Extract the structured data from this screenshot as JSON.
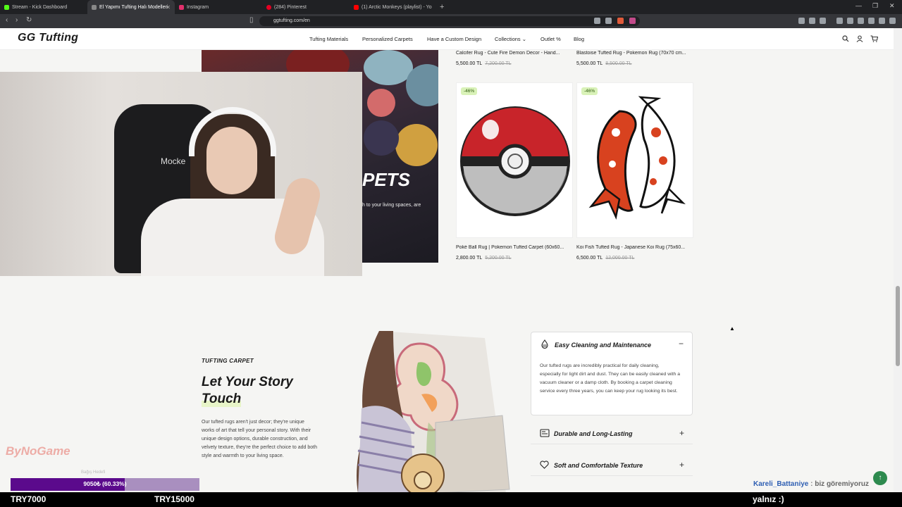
{
  "browser": {
    "tabs": [
      {
        "title": "Stream - Kick Dashboard",
        "color": "#53fc18"
      },
      {
        "title": "El Yapımı Tufting Halı Modelleri",
        "color": "#888888",
        "active": true
      },
      {
        "title": "Instagram",
        "color": "#e1306c"
      },
      {
        "title": "(284) Pinterest",
        "color": "#e60023"
      },
      {
        "title": "(1) Arctic Monkeys (playlist) - Yo",
        "color": "#ff0000"
      }
    ],
    "url": "ggtufting.com/en"
  },
  "site": {
    "logo": "GG Tufting",
    "nav": [
      "Tufting Materials",
      "Personalized Carpets",
      "Have a Custom Design",
      "Collections ⌄",
      "Outlet %",
      "Blog"
    ]
  },
  "hero": {
    "title": "PETS",
    "text": "h to your living spaces, are"
  },
  "webcam": {
    "chair_text": "Mocke"
  },
  "products_top": [
    {
      "title": "Calcifer Rug - Cute Fire Demon Decor - Hand...",
      "price": "5,500.00 TL",
      "old_price": "7,200.00 TL"
    },
    {
      "title": "Blastoise Tufted Rug - Pokemon Rug (70x70 cm...",
      "price": "5,500.00 TL",
      "old_price": "8,500.00 TL"
    }
  ],
  "products": [
    {
      "discount": "-46%",
      "title": "Poké Ball Rug | Pokemon Tufted Carpet (60x60...",
      "price": "2,800.00 TL",
      "old_price": "5,200.00 TL"
    },
    {
      "discount": "-46%",
      "title": "Koi Fish Tufted Rug - Japanese Koi Rug (75x60...",
      "price": "6,500.00 TL",
      "old_price": "12,000.00 TL"
    }
  ],
  "section": {
    "kicker": "TUFTING CARPET",
    "heading_line1": "Let Your Story",
    "heading_line2": "Touch",
    "body": "Our tufted rugs aren't just decor; they're unique works of art that tell your personal story. With their unique design options, durable construction, and velvety texture, they're the perfect choice to add both style and warmth to your living space."
  },
  "accordion": [
    {
      "title": "Easy Cleaning and Maintenance",
      "icon": "droplet-icon",
      "toggle": "−",
      "body": "Our tufted rugs are incredibly practical for daily cleaning, especially for light dirt and dust. They can be easily cleaned with a vacuum cleaner or a damp cloth. By booking a carpet cleaning service every three years, you can keep your rug looking its best."
    },
    {
      "title": "Durable and Long-Lasting",
      "icon": "shield-icon",
      "toggle": "+"
    },
    {
      "title": "Soft and Comfortable Texture",
      "icon": "heart-icon",
      "toggle": "+"
    }
  ],
  "stream": {
    "logo": "ByNoGame",
    "goal_sub": "Bağış Hedefi",
    "goal_text": "9050₺ (60.33%)",
    "goal_progress": 0.6033,
    "goal_left": "TRY7000",
    "goal_right": "TRY15000",
    "ticker_text": "yalnız :)",
    "chat_name": "Kareli_Battaniye",
    "chat_sep": ":",
    "chat_text": "biz göremiyoruz"
  },
  "colors": {
    "accent_green": "#2d8a4e",
    "goal_purple": "#5b0a8c",
    "discount_bg": "#d9f2b8"
  }
}
